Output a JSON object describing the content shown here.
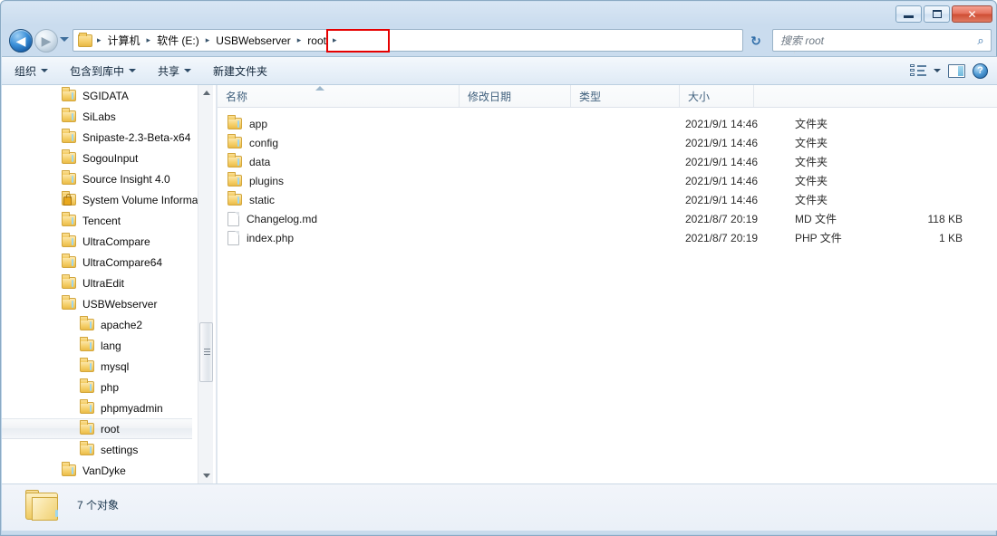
{
  "window": {
    "controls": [
      {
        "name": "minimize",
        "label": "–"
      },
      {
        "name": "maximize",
        "label": "□"
      },
      {
        "name": "close",
        "label": "✕"
      }
    ]
  },
  "address_bar": {
    "back_icon": "◀",
    "forward_icon": "▶",
    "crumbs": [
      {
        "label": "计算机"
      },
      {
        "label": "软件 (E:)"
      },
      {
        "label": "USBWebserver"
      },
      {
        "label": "root"
      }
    ],
    "separator": "▸",
    "refresh_icon": "↻",
    "highlight_color": "#e60000"
  },
  "search": {
    "placeholder": "搜索 root",
    "icon": "⌕"
  },
  "toolbar": {
    "items": [
      {
        "label": "组织",
        "caret": true
      },
      {
        "label": "包含到库中",
        "caret": true
      },
      {
        "label": "共享",
        "caret": true
      },
      {
        "label": "新建文件夹",
        "caret": false
      }
    ],
    "right_icons": [
      "view-list-icon",
      "chevron-down-icon",
      "preview-pane-icon",
      "help-icon"
    ],
    "help_label": "?"
  },
  "sidebar": {
    "items": [
      {
        "label": "SGIDATA",
        "indent": 0,
        "icon": "folder-icon",
        "selected": false
      },
      {
        "label": "SiLabs",
        "indent": 0,
        "icon": "folder-icon",
        "selected": false
      },
      {
        "label": "Snipaste-2.3-Beta-x64",
        "indent": 0,
        "icon": "folder-icon",
        "selected": false
      },
      {
        "label": "SogouInput",
        "indent": 0,
        "icon": "folder-icon",
        "selected": false
      },
      {
        "label": "Source Insight 4.0",
        "indent": 0,
        "icon": "folder-icon",
        "selected": false
      },
      {
        "label": "System Volume Informa",
        "indent": 0,
        "icon": "locked-folder-icon",
        "selected": false
      },
      {
        "label": "Tencent",
        "indent": 0,
        "icon": "folder-icon",
        "selected": false
      },
      {
        "label": "UltraCompare",
        "indent": 0,
        "icon": "folder-icon",
        "selected": false
      },
      {
        "label": "UltraCompare64",
        "indent": 0,
        "icon": "folder-icon",
        "selected": false
      },
      {
        "label": "UltraEdit",
        "indent": 0,
        "icon": "folder-icon",
        "selected": false
      },
      {
        "label": "USBWebserver",
        "indent": 0,
        "icon": "folder-icon",
        "selected": false
      },
      {
        "label": "apache2",
        "indent": 1,
        "icon": "folder-icon",
        "selected": false
      },
      {
        "label": "lang",
        "indent": 1,
        "icon": "folder-icon",
        "selected": false
      },
      {
        "label": "mysql",
        "indent": 1,
        "icon": "folder-icon",
        "selected": false
      },
      {
        "label": "php",
        "indent": 1,
        "icon": "folder-icon",
        "selected": false
      },
      {
        "label": "phpmyadmin",
        "indent": 1,
        "icon": "folder-icon",
        "selected": false
      },
      {
        "label": "root",
        "indent": 1,
        "icon": "folder-icon",
        "selected": true
      },
      {
        "label": "settings",
        "indent": 1,
        "icon": "folder-icon",
        "selected": false
      },
      {
        "label": "VanDyke",
        "indent": 0,
        "icon": "folder-icon",
        "selected": false
      }
    ]
  },
  "file_list": {
    "columns": [
      {
        "key": "name",
        "label": "名称",
        "sorted": "asc"
      },
      {
        "key": "date",
        "label": "修改日期"
      },
      {
        "key": "type",
        "label": "类型"
      },
      {
        "key": "size",
        "label": "大小"
      }
    ],
    "rows": [
      {
        "name": "app",
        "date": "2021/9/1 14:46",
        "type": "文件夹",
        "size": "",
        "icon": "folder-icon"
      },
      {
        "name": "config",
        "date": "2021/9/1 14:46",
        "type": "文件夹",
        "size": "",
        "icon": "folder-icon"
      },
      {
        "name": "data",
        "date": "2021/9/1 14:46",
        "type": "文件夹",
        "size": "",
        "icon": "folder-icon"
      },
      {
        "name": "plugins",
        "date": "2021/9/1 14:46",
        "type": "文件夹",
        "size": "",
        "icon": "folder-icon"
      },
      {
        "name": "static",
        "date": "2021/9/1 14:46",
        "type": "文件夹",
        "size": "",
        "icon": "folder-icon"
      },
      {
        "name": "Changelog.md",
        "date": "2021/8/7 20:19",
        "type": "MD 文件",
        "size": "118 KB",
        "icon": "file-icon"
      },
      {
        "name": "index.php",
        "date": "2021/8/7 20:19",
        "type": "PHP 文件",
        "size": "1 KB",
        "icon": "file-icon"
      }
    ]
  },
  "status_bar": {
    "text": "7 个对象"
  }
}
